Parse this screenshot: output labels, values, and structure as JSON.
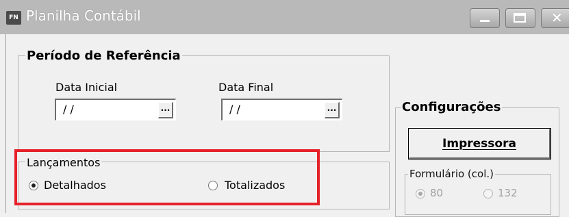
{
  "window": {
    "icon_text": "FN",
    "title": "Planilha Contábil"
  },
  "periodo": {
    "legend": "Período de Referência",
    "data_inicial_label": "Data Inicial",
    "data_inicial_value": "/ /",
    "data_final_label": "Data Final",
    "data_final_value": "/ /",
    "ellipsis": "..."
  },
  "lancamentos": {
    "legend": "Lançamentos",
    "options": [
      {
        "label": "Detalhados",
        "selected": true
      },
      {
        "label": "Totalizados",
        "selected": false
      }
    ]
  },
  "configuracoes": {
    "legend": "Configurações",
    "impressora_button": "Impressora",
    "formulario": {
      "legend": "Formulário (col.)",
      "options": [
        {
          "label": "80",
          "selected": true,
          "enabled": false
        },
        {
          "label": "132",
          "selected": false,
          "enabled": false
        }
      ]
    }
  },
  "colors": {
    "highlight": "#e5212a",
    "titlebar": "#b9b9b9"
  }
}
